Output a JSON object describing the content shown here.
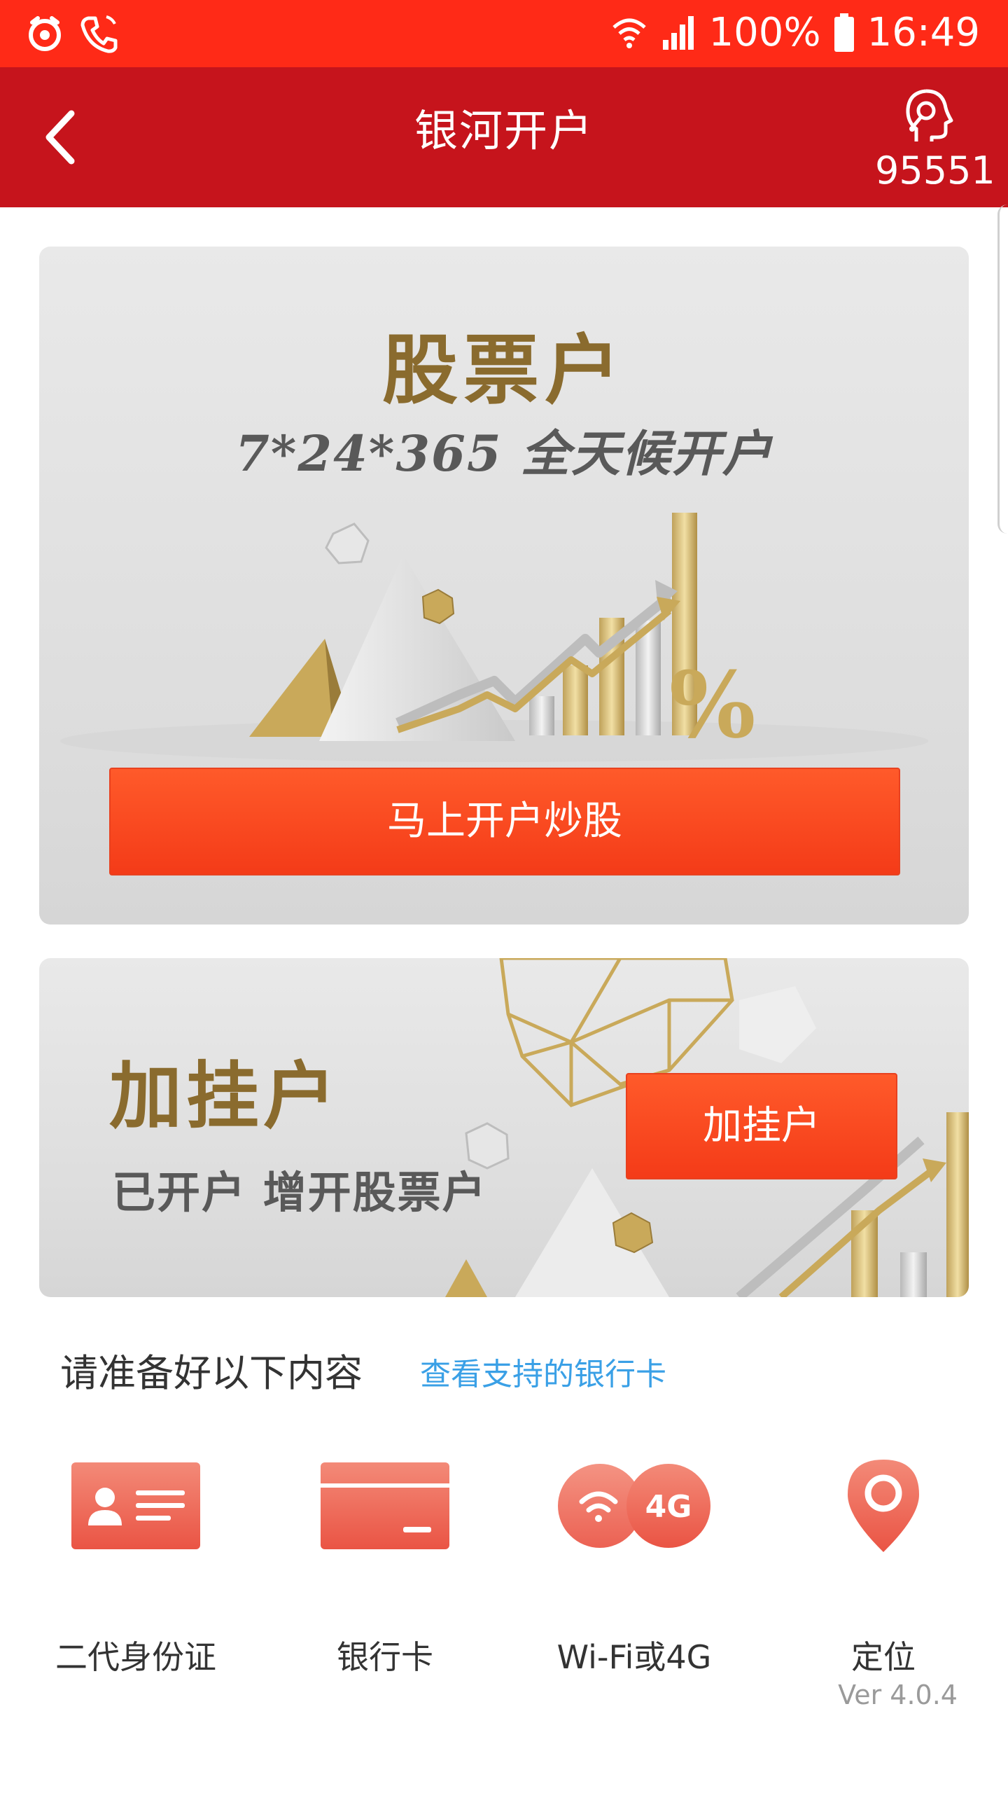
{
  "status_bar": {
    "battery": "100%",
    "time": "16:49",
    "icons": [
      "alarm-icon",
      "phone-icon",
      "wifi-icon",
      "signal-icon",
      "battery-icon"
    ]
  },
  "header": {
    "title": "银河开户",
    "hotline": "95551",
    "icons": [
      "back-icon",
      "customer-service-icon"
    ]
  },
  "stock_card": {
    "title": "股票户",
    "subtitle": "7*24*365  全天候开户",
    "button_label": "马上开户炒股"
  },
  "add_card": {
    "title": "加挂户",
    "subtitle": "已开户  增开股票户",
    "button_label": "加挂户"
  },
  "prepare": {
    "label": "请准备好以下内容",
    "link": "查看支持的银行卡",
    "items": [
      {
        "label": "二代身份证",
        "icon": "id-card-icon"
      },
      {
        "label": "银行卡",
        "icon": "bank-card-icon"
      },
      {
        "label": "Wi-Fi或4G",
        "icon": "wifi-4g-icon"
      },
      {
        "label": "定位",
        "icon": "location-icon"
      }
    ],
    "icon_badge_text": "4G"
  },
  "version": "Ver 4.0.4",
  "colors": {
    "status_bar": "#ff2a17",
    "app_bar": "#c6141c",
    "button": "#f43b18",
    "gold": "#8a6b2e",
    "link": "#3aa0e6",
    "icon_red": "#f06a5a"
  }
}
